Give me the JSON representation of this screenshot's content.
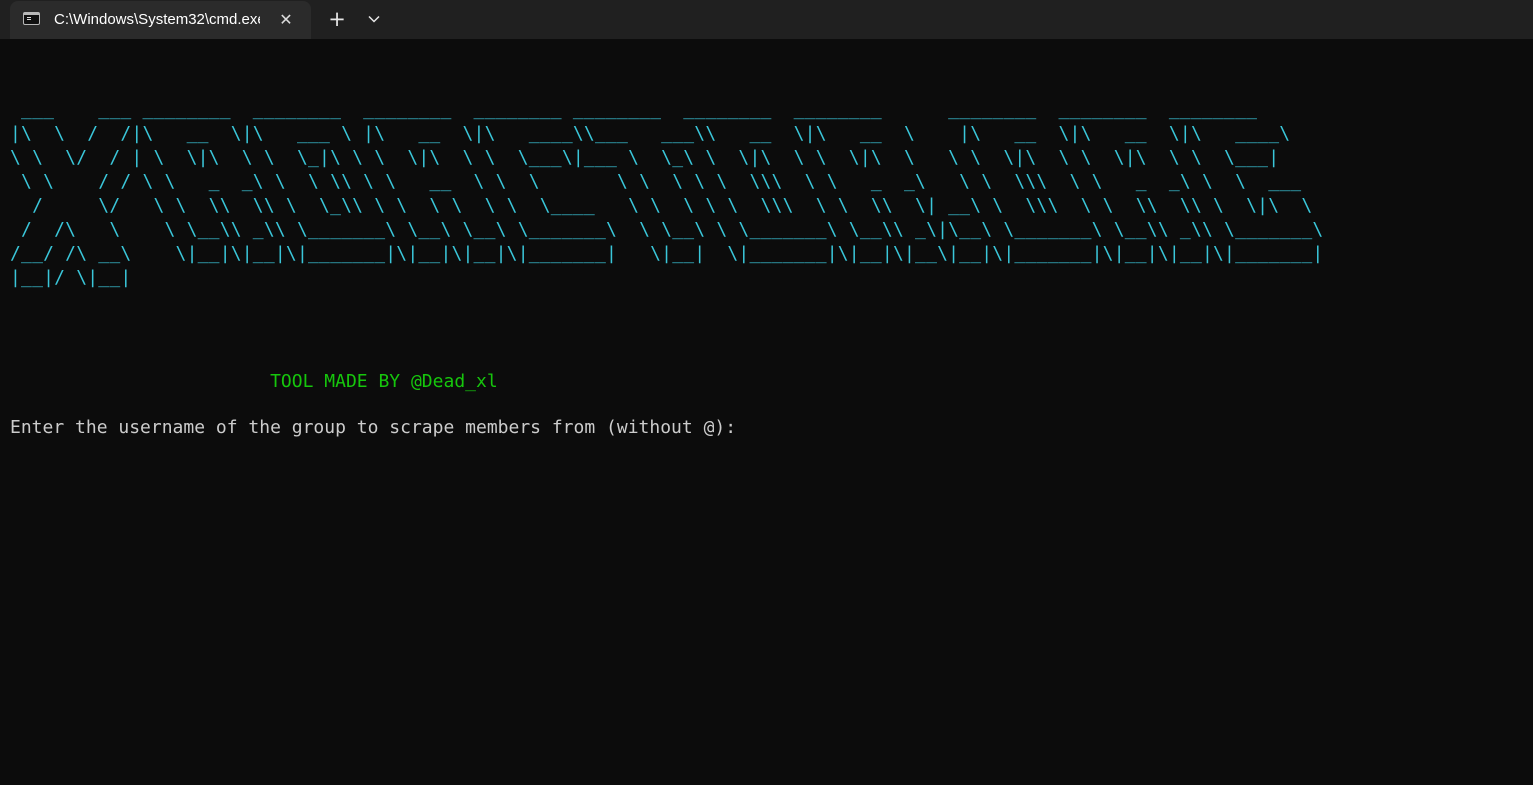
{
  "tab": {
    "title": "C:\\Windows\\System32\\cmd.exe",
    "icon": "console-icon",
    "close_glyph": "✕"
  },
  "toolbar": {
    "new_tab_glyph": "+",
    "dropdown_icon": "chevron-down-icon"
  },
  "console": {
    "banner": " ___    ___ ________  ________  ________  ________ ________  ________  ________      ________  ________  ________\n|\\  \\  /  /|\\   __  \\|\\   ___ \\ |\\   __  \\|\\   ____\\\\___   ___\\\\   __  \\|\\   __  \\    |\\   __  \\|\\   __  \\|\\   ____\\\n\\ \\  \\/  / | \\  \\|\\  \\ \\  \\_|\\ \\ \\  \\|\\  \\ \\  \\___\\|___ \\  \\_\\ \\  \\|\\  \\ \\  \\|\\  \\   \\ \\  \\|\\  \\ \\  \\|\\  \\ \\  \\___|\n \\ \\    / / \\ \\   _  _\\ \\  \\ \\\\ \\ \\   __  \\ \\  \\       \\ \\  \\ \\ \\  \\\\\\  \\ \\   _  _\\   \\ \\  \\\\\\  \\ \\   _  _\\ \\  \\  ___\n  /     \\/   \\ \\  \\\\  \\\\ \\  \\_\\\\ \\ \\  \\ \\  \\ \\  \\____   \\ \\  \\ \\ \\  \\\\\\  \\ \\  \\\\  \\| __\\ \\  \\\\\\  \\ \\  \\\\  \\\\ \\  \\|\\  \\\n /  /\\   \\    \\ \\__\\\\ _\\\\ \\_______\\ \\__\\ \\__\\ \\_______\\  \\ \\__\\ \\ \\_______\\ \\__\\\\ _\\|\\__\\ \\_______\\ \\__\\\\ _\\\\ \\_______\\\n/__/ /\\ __\\    \\|__|\\|__|\\|_______|\\|__|\\|__|\\|_______|   \\|__|  \\|_______|\\|__|\\|__\\|__|\\|_______|\\|__|\\|__|\\|_______|\n|__|/ \\|__|",
    "credit": "                        TOOL MADE BY @Dead_xl",
    "prompt": "Enter the username of the group to scrape members from (without @):",
    "colors": {
      "background": "#0c0c0c",
      "banner": "#3ac6d9",
      "credit": "#16c60c",
      "text": "#cccccc"
    }
  }
}
